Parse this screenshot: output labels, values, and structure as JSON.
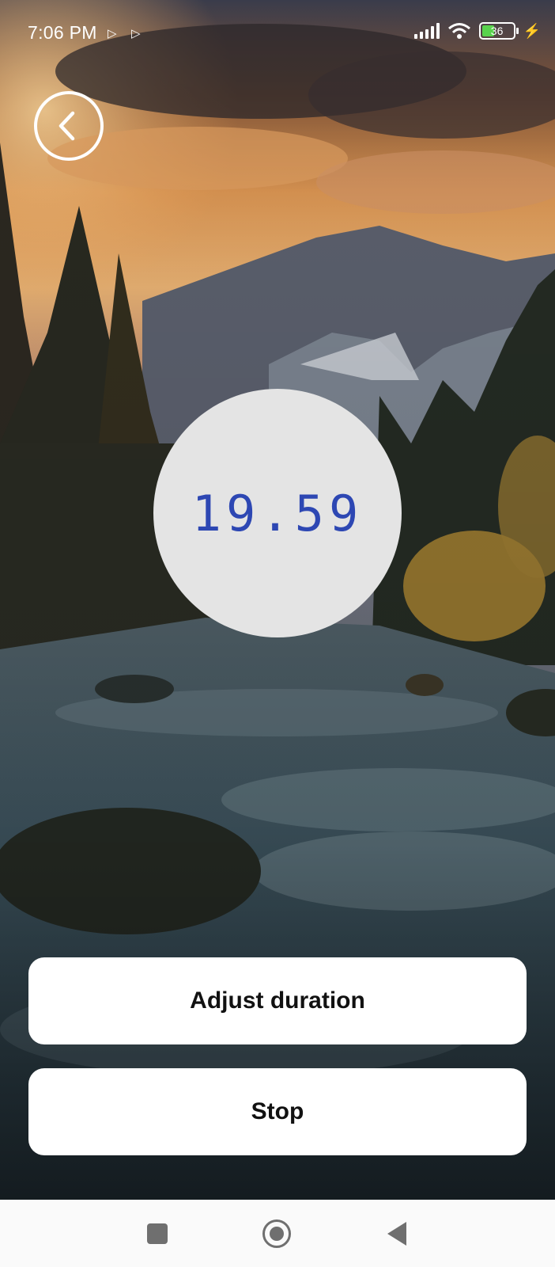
{
  "status_bar": {
    "time": "7:06 PM",
    "battery_level": "36",
    "icons": [
      "play-notification-icon",
      "play-notification-icon",
      "signal-icon",
      "wifi-icon",
      "battery-icon",
      "charging-bolt-icon"
    ]
  },
  "back_button": {
    "icon": "chevron-left-icon"
  },
  "timer": {
    "value": "19.59",
    "color": "#2d47b3"
  },
  "buttons": {
    "adjust_label": "Adjust duration",
    "stop_label": "Stop"
  },
  "nav_bar": {
    "icons": [
      "recents-square-icon",
      "home-circle-icon",
      "back-triangle-icon"
    ]
  },
  "colors": {
    "button_bg": "#ffffff",
    "circle_bg": "#e4e4e4",
    "nav_bg": "#fafafa"
  }
}
